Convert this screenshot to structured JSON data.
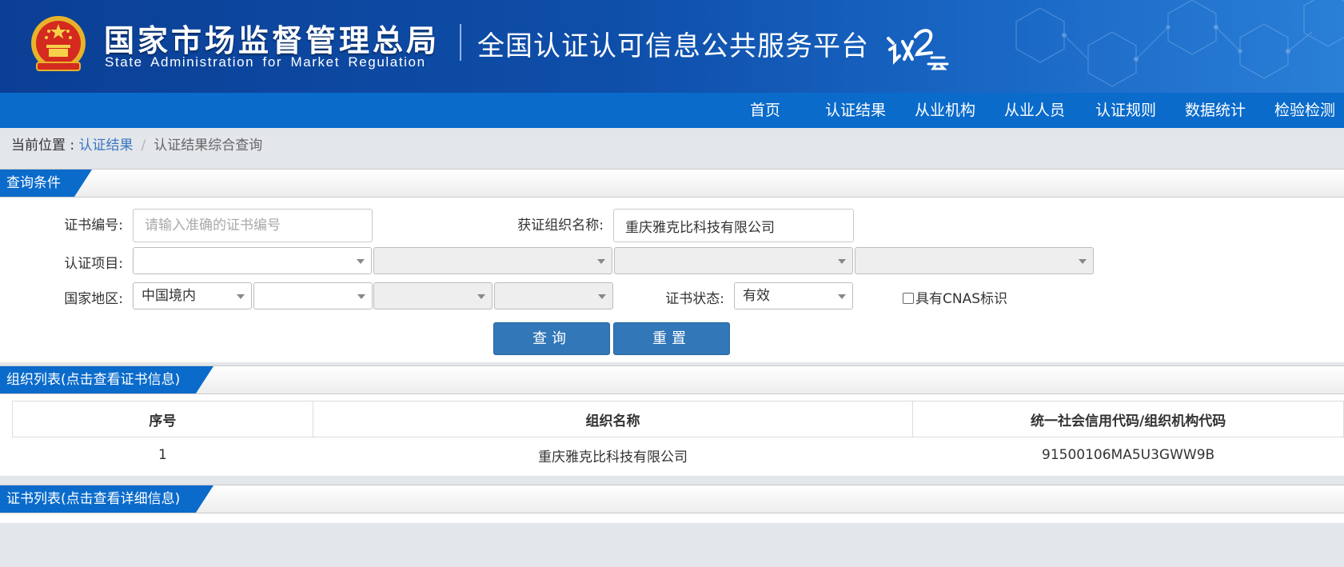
{
  "header": {
    "agency_cn": "国家市场监督管理总局",
    "agency_en": "State Administration  for  Market Regulation",
    "platform": "全国认证认可信息公共服务平台",
    "logo_text": "认云"
  },
  "nav": {
    "items": [
      "首页",
      "认证结果",
      "从业机构",
      "从业人员",
      "认证规则",
      "数据统计",
      "检验检测"
    ]
  },
  "breadcrumb": {
    "prefix": "当前位置 : ",
    "link": "认证结果",
    "separator": "/",
    "current": "认证结果综合查询"
  },
  "query": {
    "section_title": "查询条件",
    "cert_no_label": "证书编号:",
    "cert_no_placeholder": "请输入准确的证书编号",
    "cert_no_value": "",
    "org_name_label": "获证组织名称:",
    "org_name_value": "重庆雅克比科技有限公司",
    "project_label": "认证项目:",
    "project_selects": [
      "",
      "",
      "",
      ""
    ],
    "region_label": "国家地区:",
    "region_selects": [
      "中国境内",
      "",
      "",
      ""
    ],
    "status_label": "证书状态:",
    "status_value": "有效",
    "cnas_label": "具有CNAS标识",
    "search_button": "查询",
    "reset_button": "重置"
  },
  "org_list": {
    "section_title": "组织列表(点击查看证书信息)",
    "columns": [
      "序号",
      "组织名称",
      "统一社会信用代码/组织机构代码"
    ],
    "rows": [
      [
        "1",
        "重庆雅克比科技有限公司",
        "91500106MA5U3GWW9B"
      ]
    ]
  },
  "cert_list": {
    "section_title": "证书列表(点击查看详细信息)"
  },
  "colors": {
    "nav_blue": "#0a6bcb",
    "button_blue": "#3277b8",
    "link_blue": "#3a76c2"
  }
}
